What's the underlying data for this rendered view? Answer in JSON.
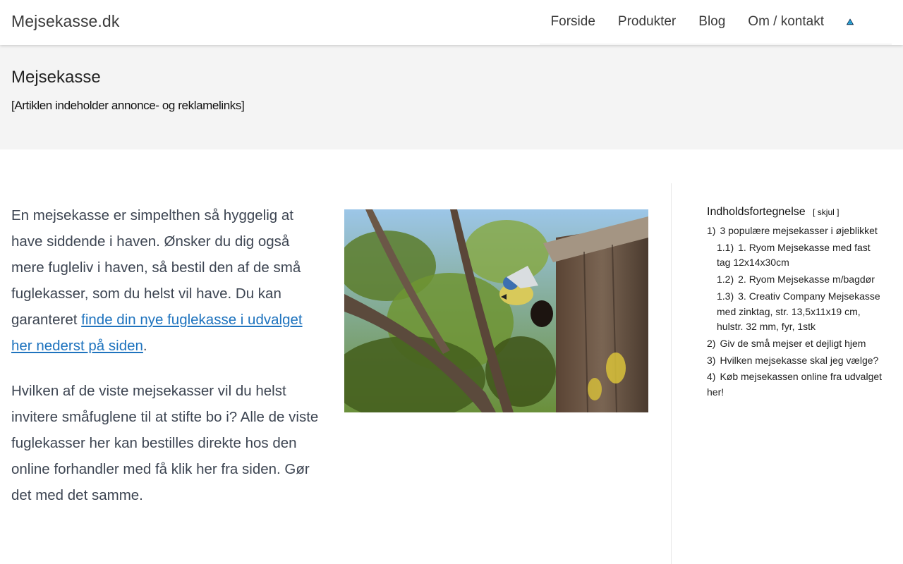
{
  "header": {
    "site_title": "Mejsekasse.dk",
    "nav": [
      {
        "label": "Forside"
      },
      {
        "label": "Produkter"
      },
      {
        "label": "Blog"
      },
      {
        "label": "Om / kontakt"
      }
    ],
    "icons": [
      "warning-triangle-icon",
      "search-icon"
    ]
  },
  "hero": {
    "title": "Mejsekasse",
    "disclaimer": "[Artiklen indeholder annonce- og reklamelinks]"
  },
  "content": {
    "p1_before_link": "En mejsekasse er simpelthen så hyggelig at have siddende i haven. Ønsker du dig også mere fugleliv i haven, så bestil den af de små fuglekasser, som du helst vil have. Du kan garanteret ",
    "p1_link": "finde din nye fuglekasse i udvalget her nederst på siden",
    "p1_after_link": ".",
    "p2": "Hvilken af de viste mejsekasser vil du helst invitere småfuglene til at stifte bo i? Alle de viste fuglekasser her kan bestilles direkte hos den online forhandler med få klik her fra siden. Gør det med det samme."
  },
  "toc": {
    "heading": "Indholdsfortegnelse",
    "toggle_open": "[",
    "toggle_label": "skjul",
    "toggle_close": "]",
    "items": [
      {
        "num": "1)",
        "text": "3 populære mejsekasser i øjeblikket"
      },
      {
        "num": "1.1)",
        "text": "1. Ryom Mejsekasse med fast tag 12x14x30cm"
      },
      {
        "num": "1.2)",
        "text": "2. Ryom Mejsekasse m/bagdør"
      },
      {
        "num": "1.3)",
        "text": "3. Creativ Company Mejsekasse med zinktag, str. 13,5x11x19 cm, hulstr. 32 mm, fyr, 1stk"
      },
      {
        "num": "2)",
        "text": "Giv de små mejser et dejligt hjem"
      },
      {
        "num": "3)",
        "text": "Hvilken mejsekasse skal jeg vælge?"
      },
      {
        "num": "4)",
        "text": "Køb mejsekassen online fra udvalget her!"
      }
    ]
  },
  "colors": {
    "link": "#1e73be",
    "hero_bg": "#f4f4f4",
    "body_text": "#3d4552"
  }
}
